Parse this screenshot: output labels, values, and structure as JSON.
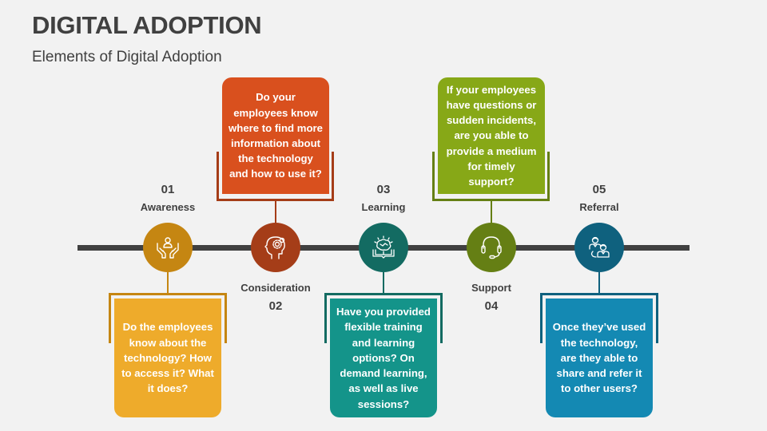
{
  "header": {
    "title": "DIGITAL ADOPTION",
    "subtitle": "Elements of Digital Adoption"
  },
  "colors": {
    "line": "#404040",
    "awareness_circle": "#c58612",
    "awareness_box": "#eeab2b",
    "consideration_circle": "#a53d18",
    "consideration_box": "#d9501e",
    "learning_circle": "#136b62",
    "learning_box": "#14948a",
    "support_circle": "#657f14",
    "support_box": "#87a817",
    "referral_circle": "#0f617e",
    "referral_box": "#1489b3"
  },
  "steps": [
    {
      "number": "01",
      "name": "Awareness",
      "icon": "hands-person-icon",
      "text": "Do the employees know about the technology? How to access it? What it does?"
    },
    {
      "number": "02",
      "name": "Consideration",
      "icon": "head-gears-icon",
      "text": "Do your employees know where to find more information about the technology and how to use it?"
    },
    {
      "number": "03",
      "name": "Learning",
      "icon": "book-brain-icon",
      "text": "Have you provided flexible training and learning options? On demand learning, as well as live sessions?"
    },
    {
      "number": "04",
      "name": "Support",
      "icon": "headset-icon",
      "text": "If your employees have questions or sudden incidents, are you able to provide a medium for timely support?"
    },
    {
      "number": "05",
      "name": "Referral",
      "icon": "people-referral-icon",
      "text": "Once they’ve used the technology, are they able to share and refer it to other users?"
    }
  ]
}
